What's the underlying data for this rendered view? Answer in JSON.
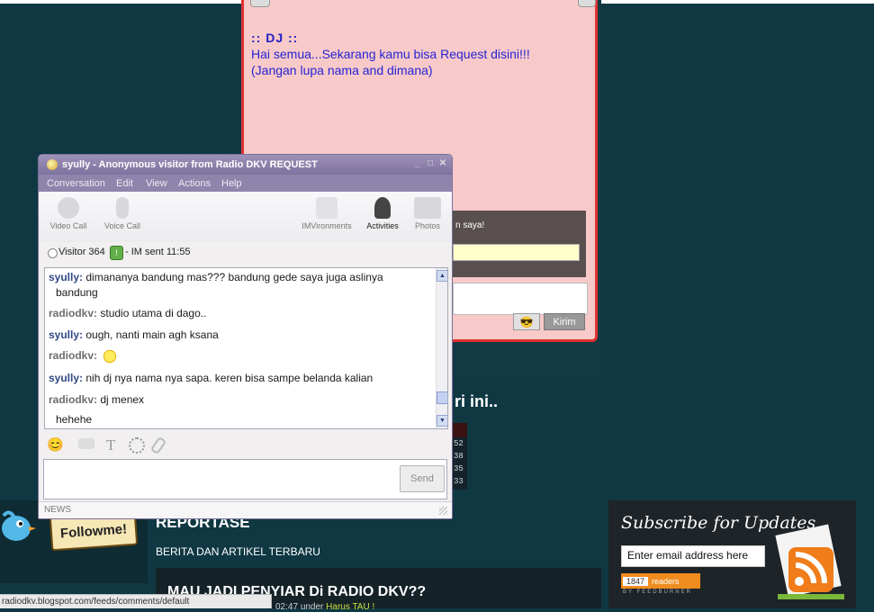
{
  "dj_box": {
    "title": ":: DJ ::",
    "line1": "Hai semua...Sekarang kamu bisa Request disini!!!",
    "line2": "(Jangan lupa nama and dimana)",
    "panel_text": "n saya!",
    "send_label": "Kirim"
  },
  "page": {
    "heading_fragment": "ri ini..",
    "stats": [
      "52",
      "38",
      "35",
      "33"
    ],
    "reportase_title": "REPORTASE",
    "reportase_subtitle": "BERITA DAN ARTIKEL TERBARU",
    "post_title": "MAU JADI PENYIAR Di RADIO DKV??",
    "post_meta_time": "02:47",
    "post_meta_under": "under",
    "post_meta_link": "Harus TAU !",
    "followme_label": "Followme!",
    "subscribe_title": "Subscribe for Updates",
    "subscribe_placeholder": "Enter email address here",
    "subscribe_count": "1847",
    "subscribe_readers": "readers",
    "feedburner": "BY FEEDBURNER"
  },
  "status_bar": {
    "url": "radiodkv.blogspot.com/feeds/comments/default"
  },
  "im_window": {
    "title": "syully - Anonymous visitor from Radio DKV REQUEST",
    "menu": [
      "Conversation",
      "Edit",
      "View",
      "Actions",
      "Help"
    ],
    "toolbar": {
      "video_call": "Video Call",
      "voice_call": "Voice Call",
      "imvironments": "IMVironments",
      "activities": "Activities",
      "photos": "Photos"
    },
    "status": {
      "visitor": "Visitor 364",
      "im_sent": "- IM sent 11:55"
    },
    "messages": [
      {
        "who": "syully:",
        "text": "dimananya bandung mas??? bandung gede saya juga aslinya"
      },
      {
        "who": "",
        "text": "bandung"
      },
      {
        "who": "radiodkv:",
        "text": "studio utama di dago.."
      },
      {
        "who": "syully:",
        "text": "ough, nanti main agh ksana"
      },
      {
        "who": "radiodkv:",
        "text": ""
      },
      {
        "who": "syully:",
        "text": "nih dj nya nama nya sapa. keren bisa sampe belanda kalian"
      },
      {
        "who": "radiodkv:",
        "text": "dj menex"
      },
      {
        "who": "",
        "text": "hehehe"
      }
    ],
    "send_label": "Send",
    "news_label": "NEWS"
  },
  "icons": {
    "emoticon": "😊",
    "text_format": "T",
    "window_min": "_",
    "window_max": "□",
    "window_close": "✕"
  }
}
